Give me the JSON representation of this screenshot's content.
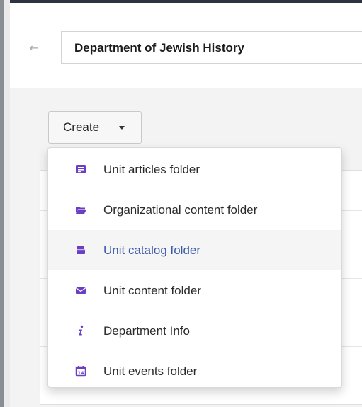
{
  "header": {
    "back_icon": "arrow-left-icon",
    "title": "Department of Jewish History"
  },
  "create_button": {
    "label": "Create"
  },
  "menu": {
    "items": [
      {
        "label": "Unit articles folder",
        "icon": "articles-folder-icon"
      },
      {
        "label": "Organizational content folder",
        "icon": "folder-open-icon"
      },
      {
        "label": "Unit catalog folder",
        "icon": "catalog-folder-icon"
      },
      {
        "label": "Unit content folder",
        "icon": "envelope-icon"
      },
      {
        "label": "Department Info",
        "icon": "info-icon"
      },
      {
        "label": "Unit events folder",
        "icon": "calendar-icon"
      }
    ],
    "hovered_index": 2
  },
  "colors": {
    "icon_purple": "#6b3fc4",
    "hover_text": "#3a5aa8"
  }
}
